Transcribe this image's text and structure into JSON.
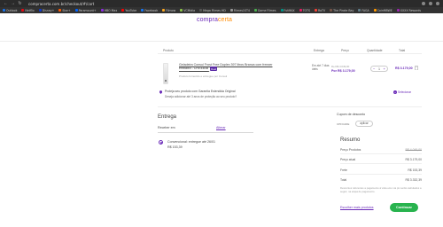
{
  "browser": {
    "url": "compracerta.com.br/checkout/#/cart",
    "bookmarks": [
      {
        "label": "Outlook",
        "color": "#1a73e8"
      },
      {
        "label": "Netflix",
        "color": "#e50914"
      },
      {
        "label": "Disney+",
        "color": "#113ccf"
      },
      {
        "label": "Star+",
        "color": "#ff5a00"
      },
      {
        "label": "Paramount+",
        "color": "#0064ff"
      },
      {
        "label": "HBO Max",
        "color": "#8e2de2"
      },
      {
        "label": "YouTube",
        "color": "#ff0000"
      },
      {
        "label": "Facebook",
        "color": "#1877f2"
      },
      {
        "label": "Filmow",
        "color": "#f6a623"
      },
      {
        "label": "VCMidia",
        "color": "#8bc34a"
      },
      {
        "label": "Mega Filmes HD",
        "color": "#555555"
      },
      {
        "label": "Filmes1ST4",
        "color": "#999999"
      },
      {
        "label": "Game Filmes",
        "color": "#4caf50"
      },
      {
        "label": "FutMAX",
        "color": "#009688"
      },
      {
        "label": "TOTS",
        "color": "#e91e63"
      },
      {
        "label": "RoTV",
        "color": "#f44336"
      },
      {
        "label": "The Pirate Bay",
        "color": "#795548"
      },
      {
        "label": "FAGA",
        "color": "#607d8b"
      },
      {
        "label": "CoinMBWE",
        "color": "#ff9800"
      },
      {
        "label": "XXXX Rewards",
        "color": "#9c27b0"
      }
    ]
  },
  "site": {
    "logo_main": "compra",
    "logo_accent": "certa"
  },
  "cart": {
    "headers": {
      "product": "Produto",
      "delivery": "Entrega",
      "price": "Preço",
      "quantity": "Quantidade",
      "total": "Total"
    },
    "item": {
      "name": "Geladeira Consul Frost Free Duplex 397 litros Branca com freezer embaixo - CRE44BB",
      "badge": "Deal",
      "sold_by": "Produto fornecido e entregue por Consul",
      "delivery": "Em até 7 dias úteis",
      "price_old": "De R$ 4.049,00",
      "price_now": "Por R$ 3.179,00",
      "quantity": "1",
      "total": "R$ 3.179,00"
    },
    "warranty": {
      "title": "Proteja seu produto com Garantia Estendida Original",
      "question": "Deseja adicionar até 3 anos de proteção ao seu produto?",
      "button": "Selecionar"
    }
  },
  "delivery": {
    "title": "Entrega",
    "receive_label": "Receber em",
    "change_link": "Alterar",
    "option": "Convencional: entregue até 26/01",
    "option_price": "R$ 153,39"
  },
  "coupon": {
    "title": "Cupom de desconto",
    "placeholder": "CPFCADE",
    "button": "aplicar"
  },
  "summary": {
    "title": "Resumo",
    "rows": [
      {
        "label": "Preço Produtos",
        "value": "R$ 4.049,00"
      },
      {
        "label": "Preço atual",
        "value": "R$ 3.179,00"
      },
      {
        "label": "Frete",
        "value": "R$ 153,39"
      },
      {
        "label": "Total",
        "value": "R$ 3.332,39"
      }
    ],
    "note": "Descontos referentes a pagamento à vista e/ou via pix serão calculados a seguir, na etapa de pagamento.",
    "choose_more": "Escolher mais produtos",
    "continue": "Continuar"
  }
}
